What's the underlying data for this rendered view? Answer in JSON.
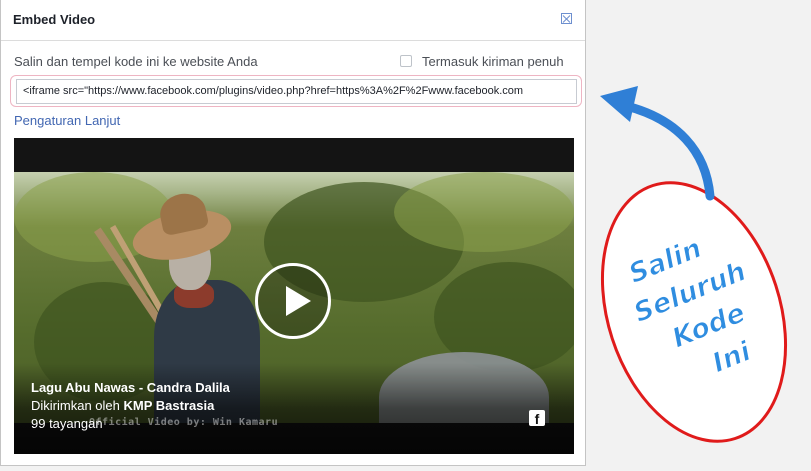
{
  "dialog": {
    "title": "Embed Video",
    "instruction": "Salin dan tempel kode ini ke website Anda",
    "checkbox_label": "Termasuk kiriman penuh",
    "embed_code": "<iframe src=\"https://www.facebook.com/plugins/video.php?href=https%3A%2F%2Fwww.facebook.com",
    "advanced_link": "Pengaturan Lanjut"
  },
  "video": {
    "title": "Lagu Abu Nawas - Candra Dalila",
    "posted_prefix": "Dikirimkan oleh",
    "posted_by": "KMP Bastrasia",
    "views": "99 tayangan",
    "watermark_credit": "Official Video by: Win Kamaru",
    "fb_logo_letter": "f"
  },
  "annotation": {
    "lines": [
      "Salin",
      "Seluruh",
      "Kode",
      "Ini"
    ],
    "colors": {
      "text": "#2f8de0",
      "arrow": "#2f7fd6",
      "circle": "#e01b1b"
    }
  },
  "icons": [
    "close-icon",
    "checkbox-icon",
    "play-icon",
    "facebook-icon",
    "arrow-icon"
  ]
}
